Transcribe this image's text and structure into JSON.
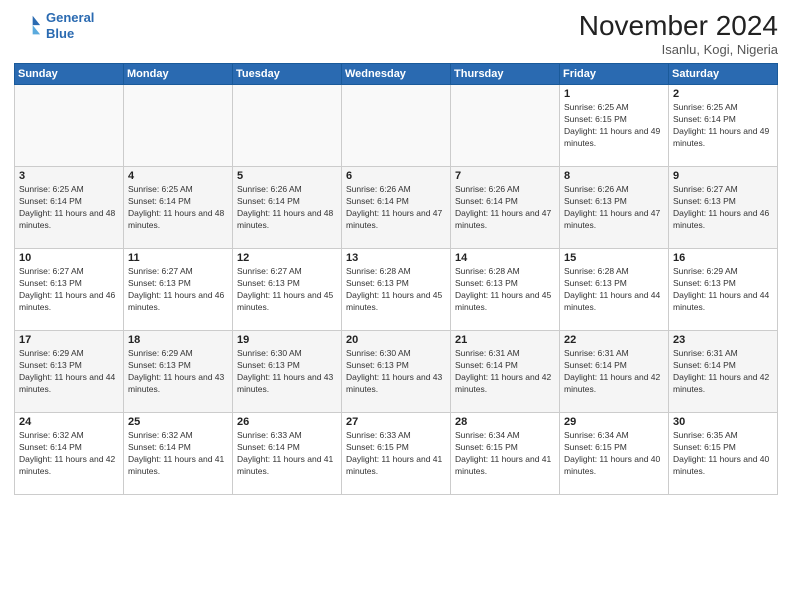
{
  "header": {
    "logo_line1": "General",
    "logo_line2": "Blue",
    "month_title": "November 2024",
    "location": "Isanlu, Kogi, Nigeria"
  },
  "weekdays": [
    "Sunday",
    "Monday",
    "Tuesday",
    "Wednesday",
    "Thursday",
    "Friday",
    "Saturday"
  ],
  "weeks": [
    [
      {
        "day": "",
        "info": ""
      },
      {
        "day": "",
        "info": ""
      },
      {
        "day": "",
        "info": ""
      },
      {
        "day": "",
        "info": ""
      },
      {
        "day": "",
        "info": ""
      },
      {
        "day": "1",
        "info": "Sunrise: 6:25 AM\nSunset: 6:15 PM\nDaylight: 11 hours and 49 minutes."
      },
      {
        "day": "2",
        "info": "Sunrise: 6:25 AM\nSunset: 6:14 PM\nDaylight: 11 hours and 49 minutes."
      }
    ],
    [
      {
        "day": "3",
        "info": "Sunrise: 6:25 AM\nSunset: 6:14 PM\nDaylight: 11 hours and 48 minutes."
      },
      {
        "day": "4",
        "info": "Sunrise: 6:25 AM\nSunset: 6:14 PM\nDaylight: 11 hours and 48 minutes."
      },
      {
        "day": "5",
        "info": "Sunrise: 6:26 AM\nSunset: 6:14 PM\nDaylight: 11 hours and 48 minutes."
      },
      {
        "day": "6",
        "info": "Sunrise: 6:26 AM\nSunset: 6:14 PM\nDaylight: 11 hours and 47 minutes."
      },
      {
        "day": "7",
        "info": "Sunrise: 6:26 AM\nSunset: 6:14 PM\nDaylight: 11 hours and 47 minutes."
      },
      {
        "day": "8",
        "info": "Sunrise: 6:26 AM\nSunset: 6:13 PM\nDaylight: 11 hours and 47 minutes."
      },
      {
        "day": "9",
        "info": "Sunrise: 6:27 AM\nSunset: 6:13 PM\nDaylight: 11 hours and 46 minutes."
      }
    ],
    [
      {
        "day": "10",
        "info": "Sunrise: 6:27 AM\nSunset: 6:13 PM\nDaylight: 11 hours and 46 minutes."
      },
      {
        "day": "11",
        "info": "Sunrise: 6:27 AM\nSunset: 6:13 PM\nDaylight: 11 hours and 46 minutes."
      },
      {
        "day": "12",
        "info": "Sunrise: 6:27 AM\nSunset: 6:13 PM\nDaylight: 11 hours and 45 minutes."
      },
      {
        "day": "13",
        "info": "Sunrise: 6:28 AM\nSunset: 6:13 PM\nDaylight: 11 hours and 45 minutes."
      },
      {
        "day": "14",
        "info": "Sunrise: 6:28 AM\nSunset: 6:13 PM\nDaylight: 11 hours and 45 minutes."
      },
      {
        "day": "15",
        "info": "Sunrise: 6:28 AM\nSunset: 6:13 PM\nDaylight: 11 hours and 44 minutes."
      },
      {
        "day": "16",
        "info": "Sunrise: 6:29 AM\nSunset: 6:13 PM\nDaylight: 11 hours and 44 minutes."
      }
    ],
    [
      {
        "day": "17",
        "info": "Sunrise: 6:29 AM\nSunset: 6:13 PM\nDaylight: 11 hours and 44 minutes."
      },
      {
        "day": "18",
        "info": "Sunrise: 6:29 AM\nSunset: 6:13 PM\nDaylight: 11 hours and 43 minutes."
      },
      {
        "day": "19",
        "info": "Sunrise: 6:30 AM\nSunset: 6:13 PM\nDaylight: 11 hours and 43 minutes."
      },
      {
        "day": "20",
        "info": "Sunrise: 6:30 AM\nSunset: 6:13 PM\nDaylight: 11 hours and 43 minutes."
      },
      {
        "day": "21",
        "info": "Sunrise: 6:31 AM\nSunset: 6:14 PM\nDaylight: 11 hours and 42 minutes."
      },
      {
        "day": "22",
        "info": "Sunrise: 6:31 AM\nSunset: 6:14 PM\nDaylight: 11 hours and 42 minutes."
      },
      {
        "day": "23",
        "info": "Sunrise: 6:31 AM\nSunset: 6:14 PM\nDaylight: 11 hours and 42 minutes."
      }
    ],
    [
      {
        "day": "24",
        "info": "Sunrise: 6:32 AM\nSunset: 6:14 PM\nDaylight: 11 hours and 42 minutes."
      },
      {
        "day": "25",
        "info": "Sunrise: 6:32 AM\nSunset: 6:14 PM\nDaylight: 11 hours and 41 minutes."
      },
      {
        "day": "26",
        "info": "Sunrise: 6:33 AM\nSunset: 6:14 PM\nDaylight: 11 hours and 41 minutes."
      },
      {
        "day": "27",
        "info": "Sunrise: 6:33 AM\nSunset: 6:15 PM\nDaylight: 11 hours and 41 minutes."
      },
      {
        "day": "28",
        "info": "Sunrise: 6:34 AM\nSunset: 6:15 PM\nDaylight: 11 hours and 41 minutes."
      },
      {
        "day": "29",
        "info": "Sunrise: 6:34 AM\nSunset: 6:15 PM\nDaylight: 11 hours and 40 minutes."
      },
      {
        "day": "30",
        "info": "Sunrise: 6:35 AM\nSunset: 6:15 PM\nDaylight: 11 hours and 40 minutes."
      }
    ]
  ]
}
